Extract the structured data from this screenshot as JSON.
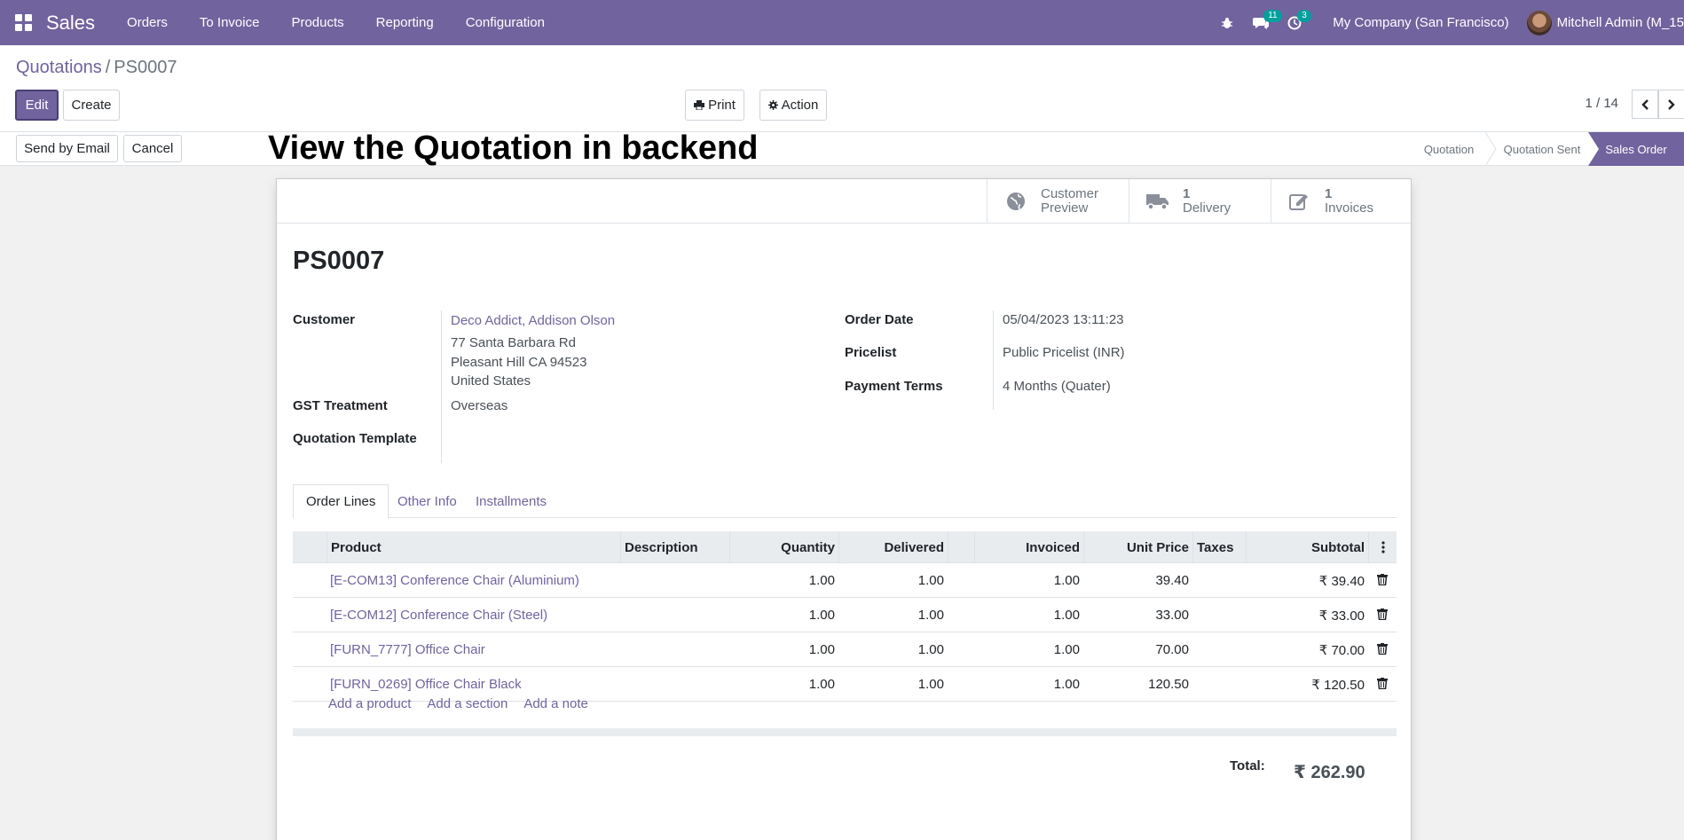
{
  "navbar": {
    "brand": "Sales",
    "menu": [
      "Orders",
      "To Invoice",
      "Products",
      "Reporting",
      "Configuration"
    ],
    "messages_count": "11",
    "activities_count": "3",
    "company": "My Company (San Francisco)",
    "user": "Mitchell Admin (M_15"
  },
  "breadcrumb": {
    "parent": "Quotations",
    "separator": "/",
    "current": "PS0007"
  },
  "toolbar": {
    "edit": "Edit",
    "create": "Create",
    "print": "Print",
    "action": "Action",
    "send_email": "Send by Email",
    "cancel": "Cancel"
  },
  "pager": {
    "value": "1 / 14"
  },
  "overlay_title": "View the Quotation in backend",
  "stages": [
    "Quotation",
    "Quotation Sent",
    "Sales Order"
  ],
  "active_stage": "Sales Order",
  "smart_buttons": {
    "preview": {
      "line1": "Customer",
      "line2": "Preview"
    },
    "delivery": {
      "count": "1",
      "label": "Delivery"
    },
    "invoices": {
      "count": "1",
      "label": "Invoices"
    }
  },
  "record": {
    "name": "PS0007",
    "customer_label": "Customer",
    "customer": "Deco Addict, Addison Olson",
    "address_line1": "77 Santa Barbara Rd",
    "address_line2": "Pleasant Hill CA 94523",
    "address_line3": "United States",
    "gst_label": "GST Treatment",
    "gst": "Overseas",
    "template_label": "Quotation Template",
    "order_date_label": "Order Date",
    "order_date": "05/04/2023 13:11:23",
    "pricelist_label": "Pricelist",
    "pricelist": "Public Pricelist (INR)",
    "payment_terms_label": "Payment Terms",
    "payment_terms": "4 Months (Quater)"
  },
  "tabs": [
    "Order Lines",
    "Other Info",
    "Installments"
  ],
  "table": {
    "headers": {
      "product": "Product",
      "description": "Description",
      "quantity": "Quantity",
      "delivered": "Delivered",
      "invoiced": "Invoiced",
      "unit_price": "Unit Price",
      "taxes": "Taxes",
      "subtotal": "Subtotal"
    },
    "rows": [
      {
        "product": "[E-COM13] Conference Chair (Aluminium)",
        "quantity": "1.00",
        "delivered": "1.00",
        "invoiced": "1.00",
        "unit_price": "39.40",
        "subtotal": "₹ 39.40"
      },
      {
        "product": "[E-COM12] Conference Chair (Steel)",
        "quantity": "1.00",
        "delivered": "1.00",
        "invoiced": "1.00",
        "unit_price": "33.00",
        "subtotal": "₹ 33.00"
      },
      {
        "product": "[FURN_7777] Office Chair",
        "quantity": "1.00",
        "delivered": "1.00",
        "invoiced": "1.00",
        "unit_price": "70.00",
        "subtotal": "₹ 70.00"
      },
      {
        "product": "[FURN_0269] Office Chair Black",
        "quantity": "1.00",
        "delivered": "1.00",
        "invoiced": "1.00",
        "unit_price": "120.50",
        "subtotal": "₹ 120.50"
      }
    ],
    "add_product": "Add a product",
    "add_section": "Add a section",
    "add_note": "Add a note"
  },
  "totals": {
    "label": "Total:",
    "value": "₹ 262.90"
  },
  "colors": {
    "brand": "#71639e",
    "badge": "#00a09d"
  }
}
